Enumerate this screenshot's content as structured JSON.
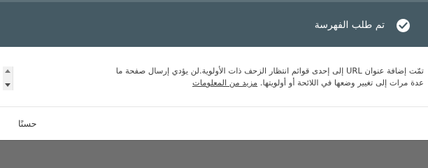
{
  "dialog": {
    "header": {
      "title": "تم طلب الفهرسة",
      "icon": "check-circle-icon"
    },
    "body": {
      "line1": "تمّت إضافة عنوان URL إلى إحدى قوائم انتظار الزحف ذات الأولوية.لن يؤدي إرسال صفحة ما",
      "line2": "عدة مرات إلى تغيير وضعها في اللائحة أو أولويتها.",
      "learn_more": "مزيد من المعلومات"
    },
    "footer": {
      "ok_label": "حسنًا"
    }
  },
  "colors": {
    "header_bg": "#455a64",
    "header_text": "#ffffff",
    "body_text": "#3c3c3c"
  }
}
